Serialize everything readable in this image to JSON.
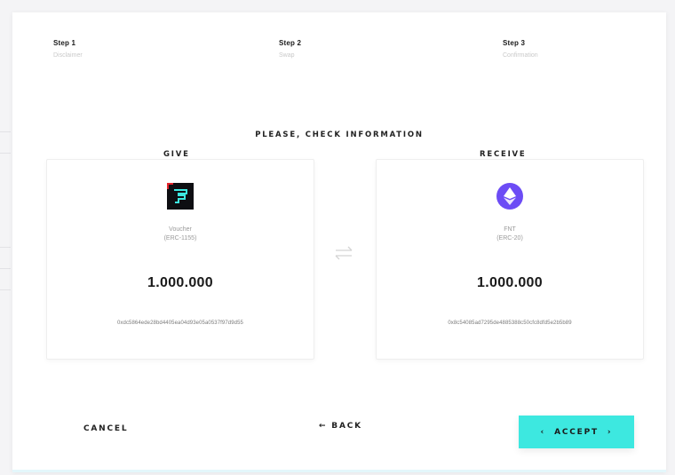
{
  "steps": [
    {
      "title": "Step 1",
      "subtitle": "Disclaimer"
    },
    {
      "title": "Step 2",
      "subtitle": "Swap"
    },
    {
      "title": "Step 3",
      "subtitle": "Confirmation"
    }
  ],
  "heading": "PLEASE, CHECK INFORMATION",
  "give": {
    "label": "GIVE",
    "icon": "voucher-token-icon",
    "token_name": "Voucher",
    "token_standard": "(ERC-1155)",
    "amount": "1.000.000",
    "address": "0xdc5864ede28bd4405ea04d93e05a0537f97d9d55"
  },
  "receive": {
    "label": "RECEIVE",
    "icon": "ethereum-token-icon",
    "token_name": "FNT",
    "token_standard": "(ERC-20)",
    "amount": "1.000.000",
    "address": "0x8c54085ad7295de4885388c50cfc8dfd5e2b5b89"
  },
  "actions": {
    "cancel_label": "CANCEL",
    "back_arrow": "←",
    "back_label": "BACK",
    "accept_left": "‹",
    "accept_label": "ACCEPT",
    "accept_right": "›"
  },
  "colors": {
    "accent": "#3de8e0",
    "eth_purple": "#6c4cf5",
    "voucher_red": "#e5242b"
  }
}
